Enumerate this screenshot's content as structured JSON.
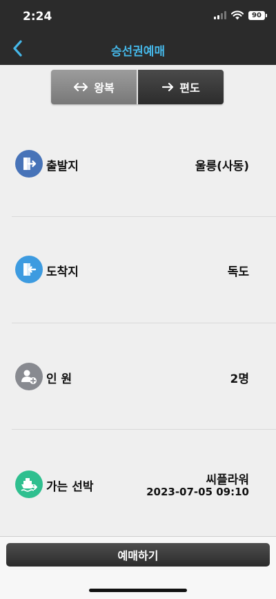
{
  "status_bar": {
    "time": "2:24",
    "battery": "90"
  },
  "nav": {
    "title": "승선권예매"
  },
  "trip_type": {
    "round_trip": {
      "icon": "left-right-arrow-icon",
      "label": "왕복"
    },
    "one_way": {
      "icon": "right-arrow-icon",
      "label": "편도"
    }
  },
  "rows": {
    "departure": {
      "label": "출발지",
      "value": "울릉(사동)",
      "icon": "exit-door-icon",
      "color": "#4773b8"
    },
    "arrival": {
      "label": "도착지",
      "value": "독도",
      "icon": "enter-door-icon",
      "color": "#3d9be0"
    },
    "passengers": {
      "label": "인 원",
      "value": "2명",
      "icon": "add-person-icon",
      "color": "#888a90"
    },
    "ship": {
      "label": "가는 선박",
      "value": "씨플라워",
      "datetime": "2023-07-05 09:10",
      "icon": "ship-icon",
      "color": "#2fbf8f"
    }
  },
  "book_button": {
    "label": "예매하기"
  }
}
